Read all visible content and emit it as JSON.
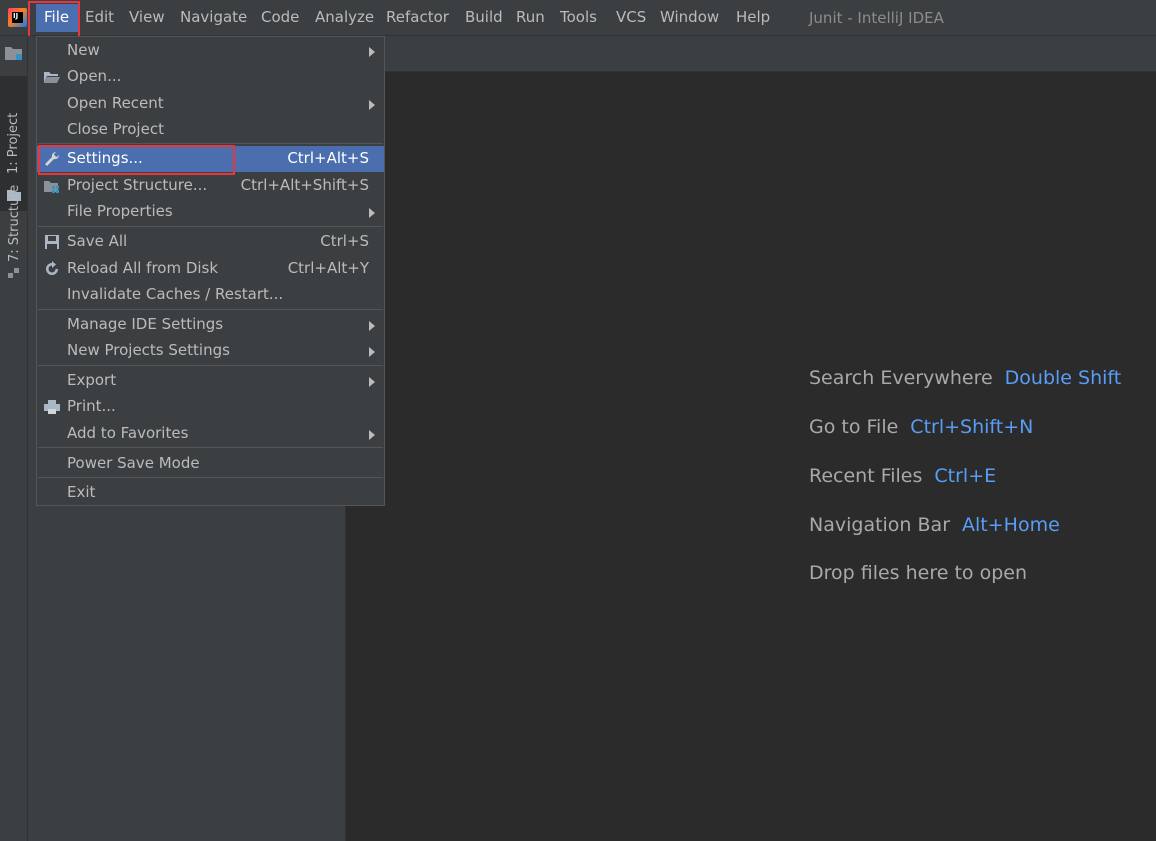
{
  "window": {
    "title": "Junit - IntelliJ IDEA"
  },
  "menubar": {
    "items": [
      {
        "id": "file",
        "label": "File",
        "mnemonic_prefix": "",
        "mnemonic": "F",
        "rest": "ile"
      },
      {
        "id": "edit",
        "label": "Edit",
        "mnemonic": "E",
        "rest": "dit"
      },
      {
        "id": "view",
        "label": "View",
        "mnemonic": "V",
        "rest": "iew"
      },
      {
        "id": "navigate",
        "label": "Navigate",
        "mnemonic": "N",
        "rest": "avigate"
      },
      {
        "id": "code",
        "label": "Code",
        "mnemonic": "C",
        "rest": "ode"
      },
      {
        "id": "analyze",
        "label": "Analyze"
      },
      {
        "id": "refactor",
        "label": "Refactor",
        "mnemonic": "R",
        "rest": "efactor"
      },
      {
        "id": "build",
        "label": "Build",
        "mnemonic": "B",
        "rest": "uild"
      },
      {
        "id": "run",
        "label": "Run"
      },
      {
        "id": "tools",
        "label": "Tools",
        "mnemonic": "T",
        "rest": "ools"
      },
      {
        "id": "vcs",
        "label": "VCS"
      },
      {
        "id": "window",
        "label": "Window",
        "mnemonic": "W",
        "rest": "indow"
      },
      {
        "id": "help",
        "label": "Help",
        "mnemonic": "H",
        "rest": "elp"
      }
    ]
  },
  "tool_strip": {
    "project_tab": "1: Project",
    "structure_tab": "7: Structure"
  },
  "file_menu": {
    "new": "New",
    "open": "Open...",
    "open_recent": "Open Recent",
    "close_project": "Close Project",
    "settings": "Settings...",
    "settings_shortcut": "Ctrl+Alt+S",
    "project_structure": "Project Structure...",
    "project_structure_shortcut": "Ctrl+Alt+Shift+S",
    "file_properties": "File Properties",
    "save_all": "Save All",
    "save_all_shortcut": "Ctrl+S",
    "reload_all": "Reload All from Disk",
    "reload_all_shortcut": "Ctrl+Alt+Y",
    "invalidate_caches": "Invalidate Caches / Restart...",
    "manage_ide_settings": "Manage IDE Settings",
    "new_projects_settings": "New Projects Settings",
    "export": "Export",
    "print": "Print...",
    "add_to_favorites": "Add to Favorites",
    "power_save_mode": "Power Save Mode",
    "exit": "Exit"
  },
  "welcome_hints": [
    {
      "label": "Search Everywhere",
      "key": "Double Shift"
    },
    {
      "label": "Go to File",
      "key": "Ctrl+Shift+N"
    },
    {
      "label": "Recent Files",
      "key": "Ctrl+E"
    },
    {
      "label": "Navigation Bar",
      "key": "Alt+Home"
    },
    {
      "label": "Drop files here to open",
      "key": ""
    }
  ],
  "colors": {
    "accent": "#4b6eaf",
    "hint_key": "#589df6",
    "highlight_box": "#e8373c"
  }
}
